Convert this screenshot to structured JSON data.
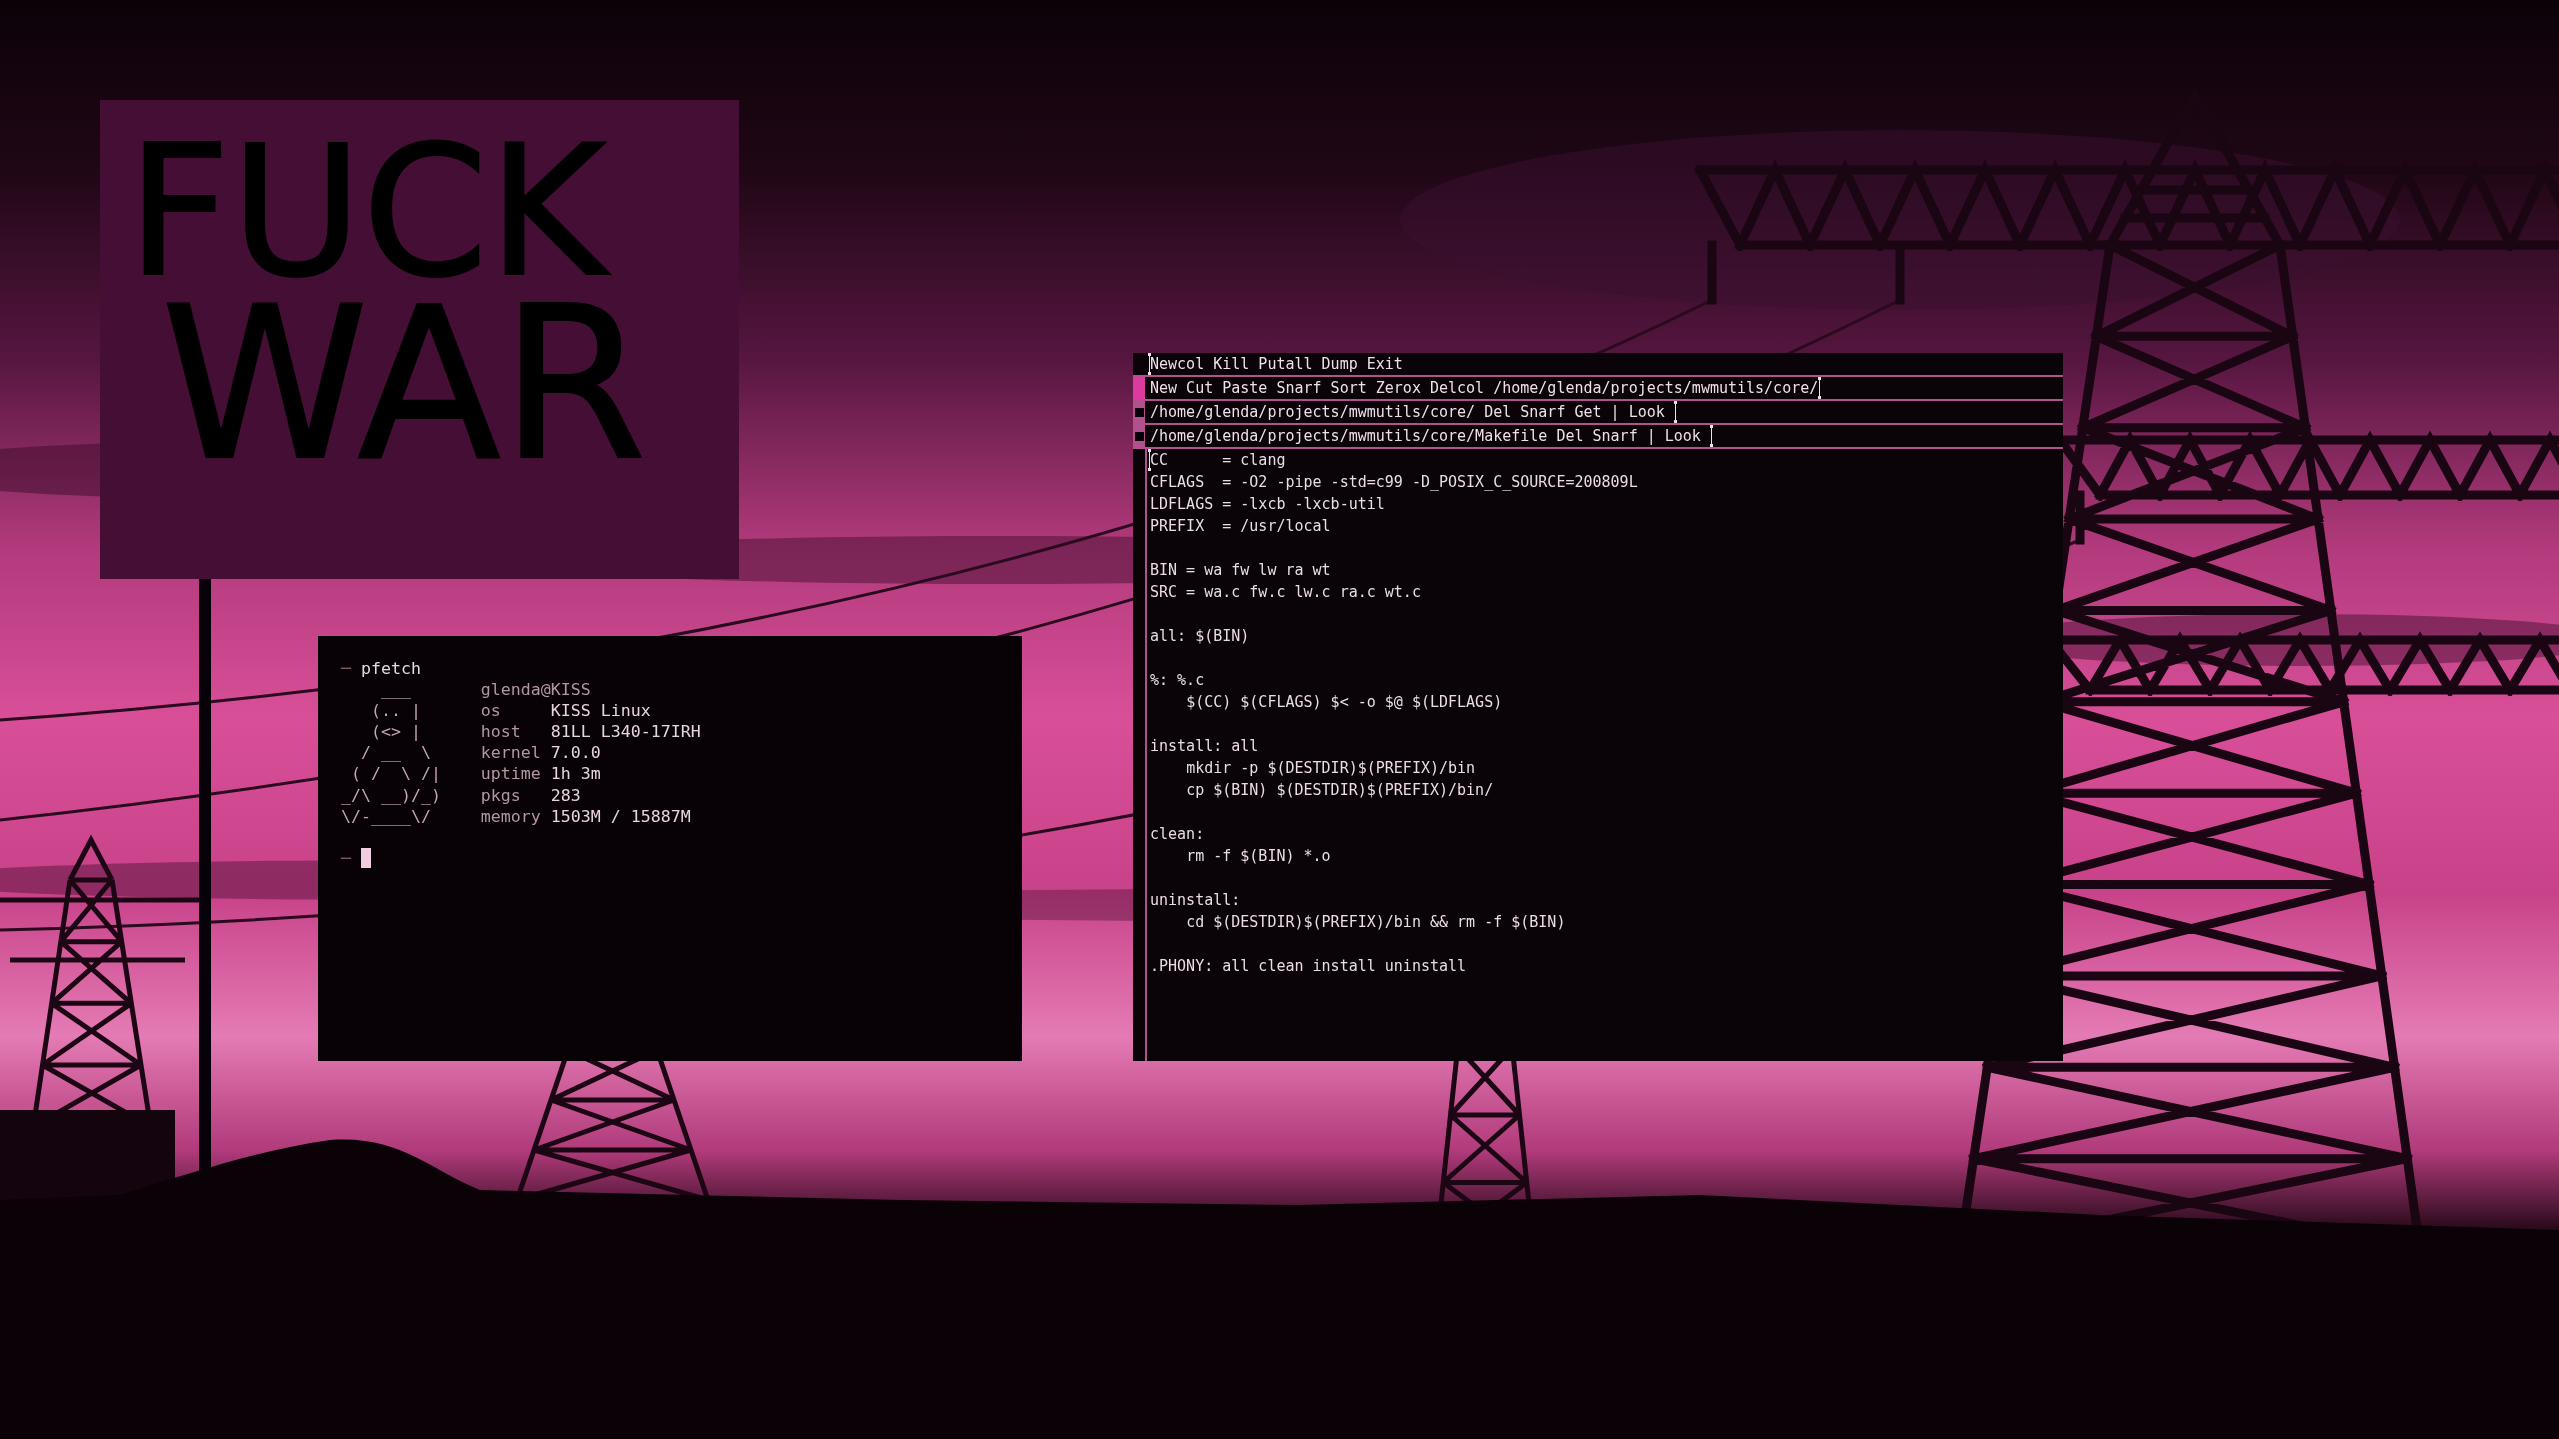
{
  "sign": {
    "lines": [
      "FUCK",
      "WAR"
    ]
  },
  "terminal": {
    "prompt": "─",
    "command": "pfetch",
    "art": [
      "    ___",
      "   (.. |",
      "   (<> |",
      "  / __  \\",
      " ( /  \\ /|",
      "_/\\ __)/_)",
      "\\/-____\\/"
    ],
    "title": "glenda@KISS",
    "fields": [
      {
        "label": "os",
        "value": "KISS Linux"
      },
      {
        "label": "host",
        "value": "81LL L340-17IRH"
      },
      {
        "label": "kernel",
        "value": "7.0.0"
      },
      {
        "label": "uptime",
        "value": "1h 3m"
      },
      {
        "label": "pkgs",
        "value": "283"
      },
      {
        "label": "memory",
        "value": "1503M / 15887M"
      }
    ],
    "next_prompt": "─",
    "cursor": true
  },
  "editor": {
    "tags": [
      {
        "kind": "main",
        "text": "Newcol Kill Putall Dump Exit",
        "cursor_before": true,
        "cursor_after": false
      },
      {
        "kind": "column",
        "text": "New Cut Paste Snarf Sort Zerox Delcol /home/glenda/projects/mwmutils/core/",
        "cursor_before": false,
        "cursor_after": true
      },
      {
        "kind": "window",
        "text": "/home/glenda/projects/mwmutils/core/ Del Snarf Get | Look ",
        "cursor_before": false,
        "cursor_after": true
      },
      {
        "kind": "window",
        "text": "/home/glenda/projects/mwmutils/core/Makefile Del Snarf | Look ",
        "cursor_before": false,
        "cursor_after": true
      }
    ],
    "body": {
      "cursor": true,
      "blocks": [
        [
          "CC      = clang",
          "CFLAGS  = -O2 -pipe -std=c99 -D_POSIX_C_SOURCE=200809L",
          "LDFLAGS = -lxcb -lxcb-util",
          "PREFIX  = /usr/local"
        ],
        [
          "BIN = wa fw lw ra wt",
          "SRC = wa.c fw.c lw.c ra.c wt.c"
        ],
        [
          "all: $(BIN)"
        ],
        [
          "%: %.c",
          "\t$(CC) $(CFLAGS) $< -o $@ $(LDFLAGS)"
        ],
        [
          "install: all",
          "\tmkdir -p $(DESTDIR)$(PREFIX)/bin",
          "\tcp $(BIN) $(DESTDIR)$(PREFIX)/bin/"
        ],
        [
          "clean:",
          "\trm -f $(BIN) *.o"
        ],
        [
          "uninstall:",
          "\tcd $(DESTDIR)$(PREFIX)/bin && rm -f $(BIN)"
        ],
        [
          ".PHONY: all clean install uninstall"
        ]
      ]
    }
  }
}
